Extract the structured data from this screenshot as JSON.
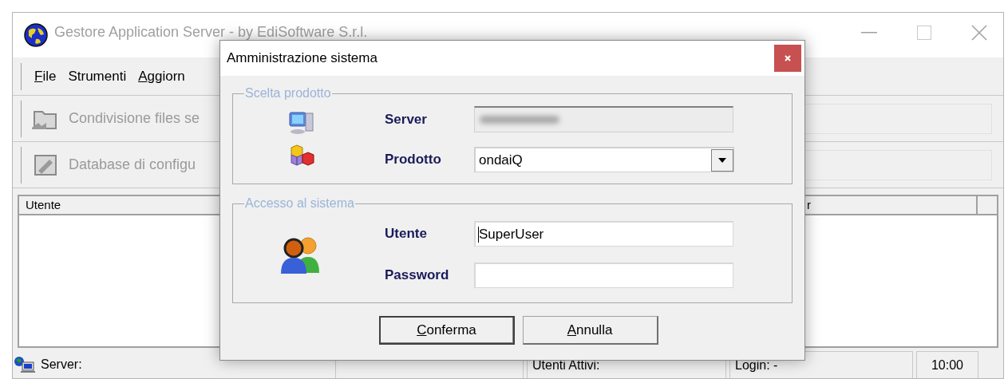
{
  "main_window": {
    "title": "Gestore Application Server - by EdiSoftware S.r.l.",
    "menu": [
      {
        "label": "File",
        "underline_first": true
      },
      {
        "label": "Strumenti",
        "underline_first": false
      },
      {
        "label": "Aggiorn",
        "underline_first": true
      }
    ],
    "toolbar_buttons": [
      "Condivisione files se",
      "Database di configu"
    ],
    "table": {
      "columns": [
        "Utente",
        "r"
      ]
    },
    "status_bar": [
      "Server:",
      "Utenti Attivi:",
      "Login: -",
      "10:00"
    ]
  },
  "dialog": {
    "title": "Amministrazione sistema",
    "groups": [
      {
        "title": "Scelta prodotto",
        "fields": [
          {
            "kind": "readonly",
            "label": "Server",
            "redacted": true
          },
          {
            "kind": "dropdown",
            "label": "Prodotto",
            "value": "ondaiQ"
          }
        ]
      },
      {
        "title": "Accesso al sistema",
        "fields": [
          {
            "kind": "text",
            "label": "Utente",
            "value": "SuperUser",
            "focused": true
          },
          {
            "kind": "password",
            "label": "Password",
            "focused": false
          }
        ]
      }
    ],
    "buttons": [
      {
        "label": "Conferma",
        "default": true
      },
      {
        "label": "Annulla",
        "default": false
      }
    ]
  }
}
